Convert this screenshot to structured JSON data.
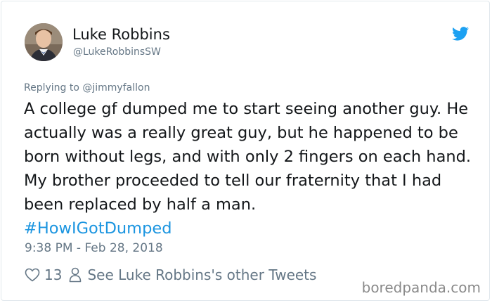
{
  "user": {
    "name": "Luke Robbins",
    "handle": "@LukeRobbinsSW"
  },
  "tweet": {
    "replying_to": "Replying to @jimmyfallon",
    "text": "A college gf dumped me to start seeing another guy. He actually was a really great guy, but he happened to be born without legs, and with only 2 fingers on each hand. My brother proceeded to tell our fraternity that I had been replaced by half a man.",
    "hashtag": "#HowIGotDumped",
    "timestamp": "9:38 PM - Feb 28, 2018"
  },
  "actions": {
    "like_count": "13",
    "other_tweets_label": "See Luke Robbins's other Tweets"
  },
  "watermark": "boredpanda.com",
  "icons": {
    "bird": "twitter-bird-icon",
    "heart": "heart-icon",
    "person": "person-icon"
  },
  "colors": {
    "twitter_blue": "#1da1f2",
    "hashtag": "#1b95e0",
    "secondary_text": "#657786",
    "primary_text": "#14171a"
  }
}
